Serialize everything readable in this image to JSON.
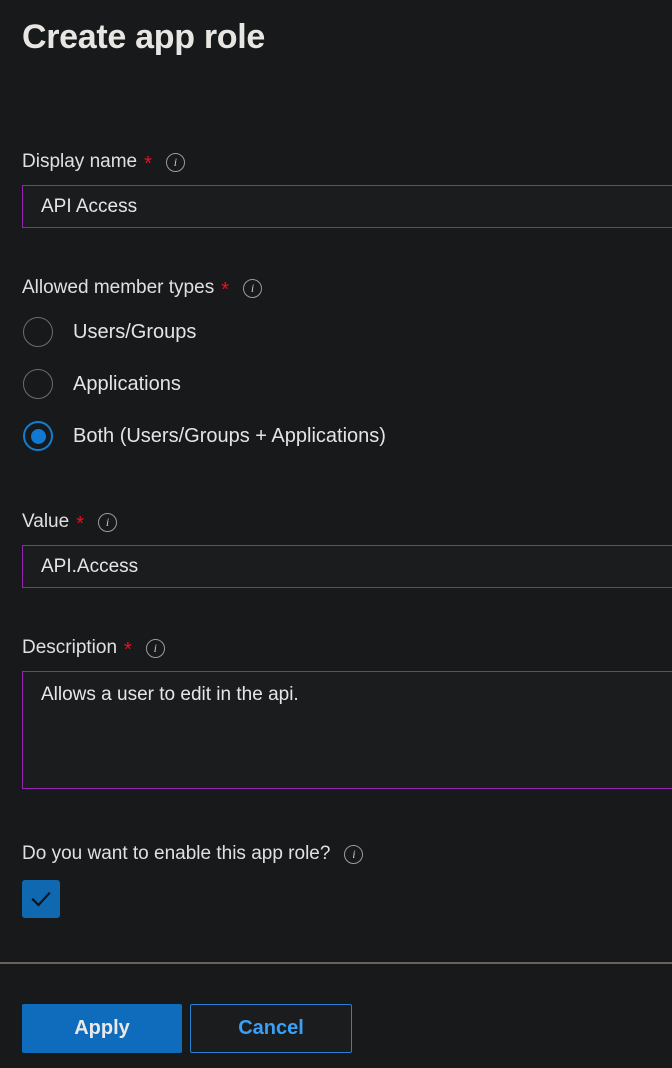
{
  "page": {
    "title": "Create app role"
  },
  "fields": {
    "display_name": {
      "label": "Display name",
      "required_mark": "*",
      "info_icon": "info-icon",
      "value": "API Access",
      "placeholder": ""
    },
    "allowed_member_types": {
      "label": "Allowed member types",
      "required_mark": "*",
      "info_icon": "info-icon",
      "selected": "Both (Users/Groups + Applications)",
      "options": [
        {
          "label": "Users/Groups",
          "selected": false
        },
        {
          "label": "Applications",
          "selected": false
        },
        {
          "label": "Both (Users/Groups + Applications)",
          "selected": true
        }
      ]
    },
    "value": {
      "label": "Value",
      "required_mark": "*",
      "info_icon": "info-icon",
      "value": "API.Access",
      "placeholder": ""
    },
    "description": {
      "label": "Description",
      "required_mark": "*",
      "info_icon": "info-icon",
      "value": "Allows a user to edit in the api.",
      "placeholder": ""
    },
    "enable_app_role": {
      "label": "Do you want to enable this app role?",
      "info_icon": "info-icon",
      "checked": true,
      "check_icon": "checkmark-icon"
    }
  },
  "footer": {
    "apply_label": "Apply",
    "cancel_label": "Cancel"
  },
  "colors": {
    "background": "#18191b",
    "input_border": "#9a20b8",
    "accent_blue": "#0f6cbd",
    "link_blue": "#3aa0f5",
    "required_red": "#e81123",
    "separator": "#6b6154",
    "radio_selected": "#1279d3"
  }
}
